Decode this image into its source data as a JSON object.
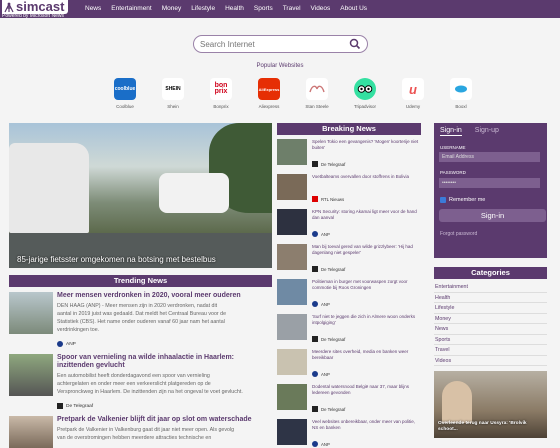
{
  "brand": {
    "name": "simcast",
    "powered_by": "Powered by Microsoft News"
  },
  "nav": [
    "News",
    "Entertainment",
    "Money",
    "Lifestyle",
    "Health",
    "Sports",
    "Travel",
    "Videos",
    "About Us"
  ],
  "search": {
    "placeholder": "Search Internet"
  },
  "popular": {
    "title": "Popular Websites",
    "sites": [
      {
        "label": "Coolblue",
        "logo_text": "coolblue",
        "color": "#1a6ec8"
      },
      {
        "label": "Shein",
        "logo_text": "SHEIN",
        "color": "#ffffff"
      },
      {
        "label": "Bonprix",
        "logo_text": "bon prix",
        "color": "#ffffff"
      },
      {
        "label": "Aliexpress",
        "logo_text": "AliExpress",
        "color": "#e62e04"
      },
      {
        "label": "Stan Steele",
        "logo_text": "",
        "color": "#ffffff"
      },
      {
        "label": "Tripadvisor",
        "logo_text": "",
        "color": "#34e0a1"
      },
      {
        "label": "Udemy",
        "logo_text": "u",
        "color": "#ffffff"
      },
      {
        "label": "Booxl",
        "logo_text": "",
        "color": "#ffffff"
      }
    ]
  },
  "hero": {
    "caption": "85-jarige fietsster omgekomen na botsing met bestelbus"
  },
  "trending": {
    "title": "Trending News",
    "items": [
      {
        "title": "Meer mensen verdronken in 2020, vooral meer ouderen",
        "text": "DEN HAAG (ANP) - Meer mensen zijn in 2020 verdronken dan in 2019. Dat meldt het Centraal Bureau voor de Statistiek (CBS). Het aantal ouderen dat in 2019 juist was gedaald. Het aantal mensen ouder dan 60 jaar nam het sterkst toe.",
        "lines": [
          "DEN HAAG (ANP) - Meer mensen zijn in 2020 verdronken, nadat dit",
          "aantal in 2019 juist was gedaald. Dat meldt het Centraal Bureau voor de",
          "Statistiek (CBS). Het name onder ouderen vanaf 60 jaar nam het aantal",
          "verdrinkingen toe."
        ],
        "source": "ANP"
      },
      {
        "title": "Spoor van vernieling na wilde inhaalactie in Haarlem: inzittenden gevlucht",
        "lines": [
          "Een automobilist heeft donderdagavond een spoor van vernieling",
          "achtergelaten en onder meer een verkeerslicht platgereden op de",
          "Verspronckweg in Haarlem. De inzittenden zijn na het ongeval te voet gevlucht."
        ],
        "source": "De Telegraaf"
      },
      {
        "title": "Pretpark de Valkenier blijft dit jaar op slot om waterschade",
        "lines": [
          "Pretpark de Valkenier in Valkenburg gaat dit jaar niet meer open. Als gevolg",
          "van de overstromingen hebben meerdere attracties technische en"
        ],
        "source": ""
      }
    ]
  },
  "breaking": {
    "title": "Breaking News",
    "items": [
      {
        "title": "Spelen Tokio een gevangenis? 'Mogen’ koorterije niet buiten'",
        "source": "De Telegraaf"
      },
      {
        "title": "Voetbalteams overvallen door stoffrens in Bolivia",
        "source": "RTL Nieuws"
      },
      {
        "title": "KPN Security: storing Akamai ligt meer voor de hand dan aanval",
        "source": "ANP"
      },
      {
        "title": "Man bij toeval gered van wilde grizzlybeer: 'Hij had dagenlang niet gespeler'",
        "source": "De Telegraaf"
      },
      {
        "title": "Politieman in burger met voorwaspen zorgt voor commotie bij Roos Groningen",
        "source": "ANP"
      },
      {
        "title": "'Surf niet te jeggen die zich in Almere woon onderks intpolgiging'",
        "source": "De Telegraaf"
      },
      {
        "title": "Meerdere sites overheid, media en banken weer bereikbaar",
        "source": "ANP"
      },
      {
        "title": "Dodental watersnood België naar 37, maar blijns ledereen gevonden",
        "source": "De Telegraaf"
      },
      {
        "title": "Veel websites onbereikbaar, onder meer van politie, NS en banken",
        "source": "ANP"
      }
    ]
  },
  "signin": {
    "tab_signin": "Sign-in",
    "tab_signup": "Sign-up",
    "username_label": "USERNAME",
    "username_placeholder": "Email Address",
    "password_label": "PASSWORD",
    "password_value": "••••••••",
    "remember": "Remember me",
    "button": "Sign-in",
    "forgot": "Forgot password"
  },
  "categories": {
    "title": "Categories",
    "items": [
      "Entertainment",
      "Health",
      "Lifestyle",
      "Money",
      "News",
      "Sports",
      "Travel",
      "Videos"
    ]
  },
  "promo": {
    "caption": "Overleende terug naar Ussyra: 'Brolvik schoot..."
  }
}
